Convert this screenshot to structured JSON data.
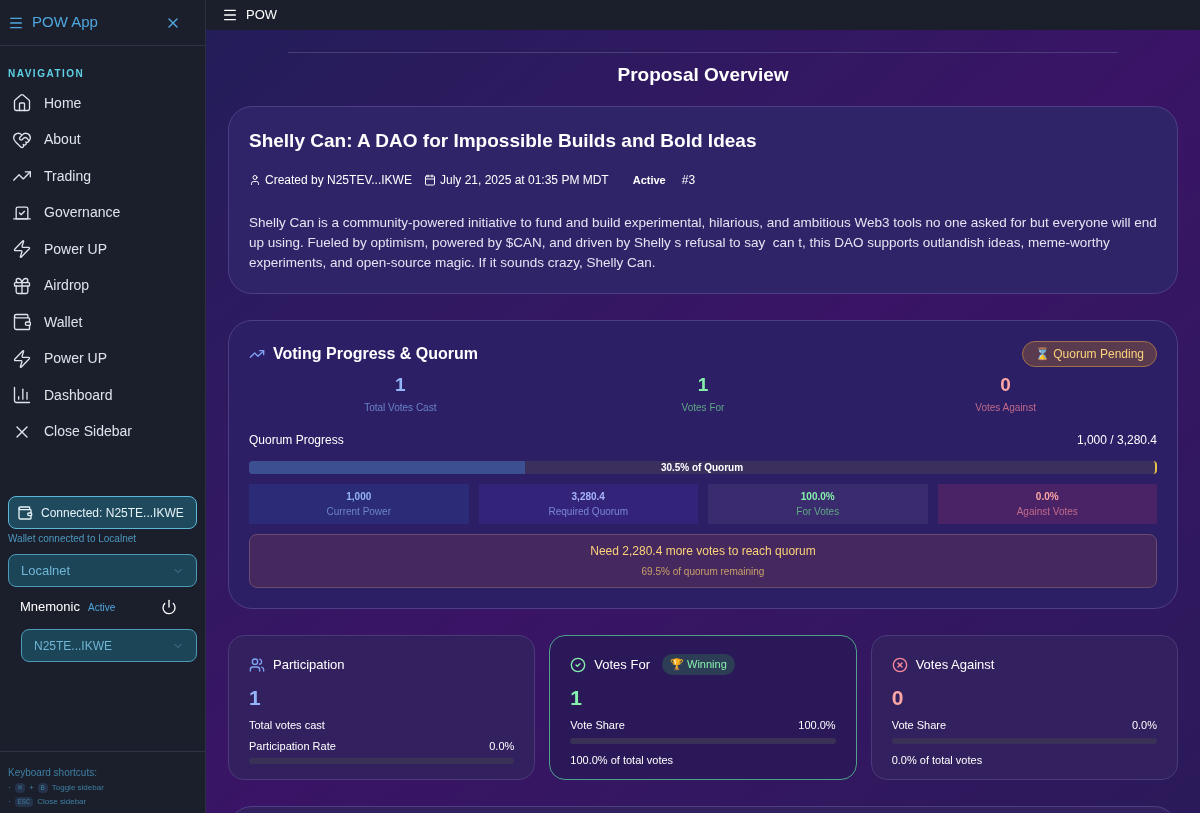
{
  "sidebar": {
    "title": "POW App",
    "section": "NAVIGATION",
    "items": [
      {
        "kind": "home",
        "label": "Home"
      },
      {
        "kind": "heart",
        "label": "About"
      },
      {
        "kind": "trend",
        "label": "Trading"
      },
      {
        "kind": "vote",
        "label": "Governance"
      },
      {
        "kind": "zap",
        "label": "Power UP"
      },
      {
        "kind": "gift",
        "label": "Airdrop"
      },
      {
        "kind": "wallet",
        "label": "Wallet"
      },
      {
        "kind": "zap",
        "label": "Power UP"
      },
      {
        "kind": "chart",
        "label": "Dashboard"
      },
      {
        "kind": "close",
        "label": "Close Sidebar"
      }
    ],
    "wallet_button": "Connected: N25TE...IKWE",
    "wallet_note": "Wallet connected to Localnet",
    "network": "Localnet",
    "mnemonic": {
      "label": "Mnemonic",
      "status": "Active"
    },
    "account": "N25TE...IKWE",
    "shortcuts": {
      "title": "Keyboard shortcuts:",
      "rows": [
        {
          "bullet": "·",
          "keys": [
            "⌘",
            "B"
          ],
          "joiner": "+",
          "label": "Toggle sidebar"
        },
        {
          "bullet": "·",
          "keys": [
            "ESC"
          ],
          "label": "Close sidebar"
        }
      ]
    }
  },
  "topbar": {
    "title": "POW"
  },
  "page_title": "Proposal Overview",
  "proposal": {
    "title": "Shelly Can: A DAO for Impossible Builds and Bold Ideas",
    "creator": "Created by N25TEV...IKWE",
    "date": "July 21, 2025 at 01:35 PM MDT",
    "status": "Active",
    "number": "#3",
    "description": "Shelly Can is a community-powered initiative to fund and build experimental, hilarious, and ambitious Web3 tools no one asked for but everyone will end up using. Fueled by optimism, powered by $CAN, and driven by Shelly s refusal to say  can t, this DAO supports outlandish ideas, meme-worthy experiments, and open-source magic. If it sounds crazy, Shelly Can."
  },
  "voting": {
    "title": "Voting Progress & Quorum",
    "badge": "⌛ Quorum Pending",
    "stats": [
      {
        "kind": "total",
        "value": "1",
        "label": "Total Votes Cast"
      },
      {
        "kind": "for",
        "value": "1",
        "label": "Votes For"
      },
      {
        "kind": "against",
        "value": "0",
        "label": "Votes Against"
      }
    ],
    "quorum": {
      "label": "Quorum Progress",
      "reading": "1,000 / 3,280.4",
      "level": 0.305,
      "bar_label": "30.5% of Quorum"
    },
    "tiles": [
      {
        "kind": "total",
        "value": "1,000",
        "label": "Current Power"
      },
      {
        "kind": "required",
        "value": "3,280.4",
        "label": "Required Quorum"
      },
      {
        "kind": "for",
        "value": "100.0%",
        "label": "For Votes"
      },
      {
        "kind": "against",
        "value": "0.0%",
        "label": "Against Votes"
      }
    ],
    "notice": {
      "title": "Need 2,280.4 more votes to reach quorum",
      "subtitle": "69.5% of quorum remaining"
    }
  },
  "cards": [
    {
      "kind": "participation",
      "title": "Participation",
      "value": "1",
      "caption": "Total votes cast",
      "bar_label": "Participation Rate",
      "reading": "0.0%",
      "highlighted": false
    },
    {
      "kind": "for",
      "title": "Votes For",
      "badge": "🏆 Winning",
      "value": "1",
      "bar_label": "Vote Share",
      "reading": "100.0%",
      "footer": "100.0% of total votes",
      "highlighted": true
    },
    {
      "kind": "against",
      "title": "Votes Against",
      "value": "0",
      "bar_label": "Vote Share",
      "reading": "0.0%",
      "footer": "0.0% of total votes",
      "highlighted": false
    }
  ]
}
